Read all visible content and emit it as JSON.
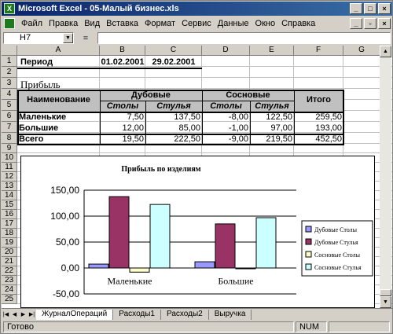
{
  "window": {
    "title": "Microsoft Excel - 05-Малый бизнес.xls",
    "icon": "excel-app-icon"
  },
  "menu": [
    "Файл",
    "Правка",
    "Вид",
    "Вставка",
    "Формат",
    "Сервис",
    "Данные",
    "Окно",
    "Справка"
  ],
  "formula_bar": {
    "name_box": "H7",
    "equals": "=",
    "content": ""
  },
  "columns": [
    "A",
    "B",
    "C",
    "D",
    "E",
    "F",
    "G"
  ],
  "rows": [
    "1",
    "2",
    "3",
    "4",
    "5",
    "6",
    "7",
    "8",
    "9",
    "10",
    "11",
    "12",
    "13",
    "14",
    "15",
    "16",
    "17",
    "18",
    "19",
    "20",
    "21",
    "22",
    "23",
    "24",
    "25"
  ],
  "sheet": {
    "period_label": "Период",
    "period_from": "01.02.2001",
    "period_to": "29.02.2001",
    "profit_title": "Прибыль",
    "hdr_name": "Наименование",
    "hdr_oak": "Дубовые",
    "hdr_pine": "Сосновые",
    "hdr_total": "Итого",
    "hdr_tables": "Столы",
    "hdr_chairs": "Стулья",
    "rows": [
      {
        "name": "Маленькие",
        "oak_tables": "7,50",
        "oak_chairs": "137,50",
        "pine_tables": "-8,00",
        "pine_chairs": "122,50",
        "total": "259,50"
      },
      {
        "name": "Большие",
        "oak_tables": "12,00",
        "oak_chairs": "85,00",
        "pine_tables": "-1,00",
        "pine_chairs": "97,00",
        "total": "193,00"
      },
      {
        "name": "Всего",
        "oak_tables": "19,50",
        "oak_chairs": "222,50",
        "pine_tables": "-9,00",
        "pine_chairs": "219,50",
        "total": "452,50"
      }
    ]
  },
  "chart_data": {
    "type": "bar",
    "title": "Прибыль по изделиям",
    "categories": [
      "Маленькие",
      "Большие"
    ],
    "series": [
      {
        "name": "Дубовые Столы",
        "values": [
          7.5,
          12.0
        ],
        "color": "#9999ff"
      },
      {
        "name": "Дубовые Стулья",
        "values": [
          137.5,
          85.0
        ],
        "color": "#993366"
      },
      {
        "name": "Сосновые Столы",
        "values": [
          -8.0,
          -1.0
        ],
        "color": "#ffffcc"
      },
      {
        "name": "Сосновые Стулья",
        "values": [
          122.5,
          97.0
        ],
        "color": "#ccffff"
      }
    ],
    "ylim": [
      -50,
      150
    ],
    "yticks": [
      "150,00",
      "100,00",
      "50,00",
      "0,00",
      "-50,00"
    ],
    "legend": "right",
    "grid": true
  },
  "tabs": [
    "ЖурналОпераций",
    "Расходы1",
    "Расходы2",
    "Выручка"
  ],
  "status": {
    "ready": "Готово",
    "num": "NUM"
  }
}
